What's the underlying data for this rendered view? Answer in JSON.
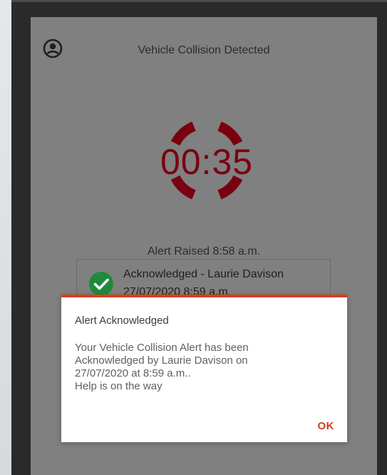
{
  "screen": {
    "title": "Vehicle Collision Detected",
    "account_icon": "account-circle-icon"
  },
  "timer": {
    "value": "00:35",
    "color": "#7a0010"
  },
  "alert": {
    "raised_text": "Alert Raised 8:58 a.m.",
    "ack_status": "Acknowledged - Laurie Davison",
    "ack_time": "27/07/2020 8:59 a.m.",
    "ack_icon": "check-circle-icon",
    "ack_icon_color": "#1e8a3c"
  },
  "dialog": {
    "title": "Alert Acknowledged",
    "message": "Your Vehicle Collision Alert has been\nAcknowledged by Laurie Davison on\n27/07/2020 at 8:59 a.m..\nHelp is on the way",
    "ok_label": "OK",
    "accent_color": "#d6401a"
  }
}
